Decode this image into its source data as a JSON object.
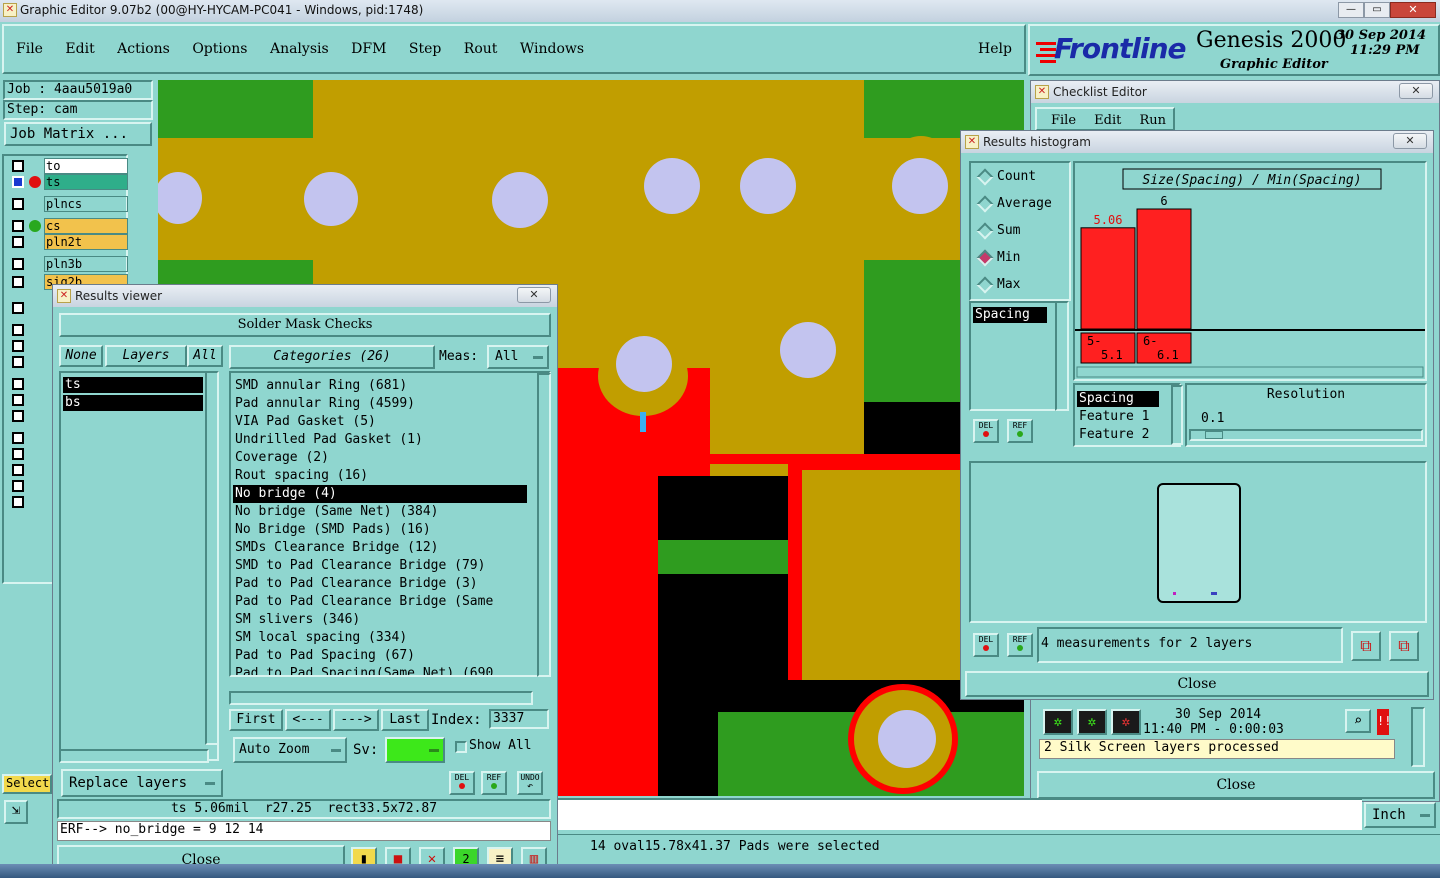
{
  "window": {
    "title": "Graphic Editor 9.07b2 (00@HY-HYCAM-PC041 - Windows, pid:1748)"
  },
  "menu": {
    "items": [
      "File",
      "Edit",
      "Actions",
      "Options",
      "Analysis",
      "DFM",
      "Step",
      "Rout",
      "Windows"
    ],
    "help": "Help"
  },
  "brand": {
    "logo": "Frontline",
    "product": "Genesis 2000",
    "subtitle": "Graphic Editor",
    "date": "30 Sep 2014",
    "time": "11:29 PM"
  },
  "job": {
    "job_label": "Job : 4aau5019a0",
    "step_label": "Step: cam",
    "matrix_button": "Job Matrix ..."
  },
  "layers": [
    {
      "name": "to"
    },
    {
      "name": "ts"
    },
    {
      "name": "plncs"
    },
    {
      "name": "cs"
    },
    {
      "name": "pln2t"
    },
    {
      "name": "pln3b"
    },
    {
      "name": "sig2b"
    }
  ],
  "select_label": "Select",
  "results_viewer": {
    "title": "Results viewer",
    "header": "Solder Mask Checks",
    "buttons": {
      "none": "None",
      "layers": "Layers",
      "all": "All",
      "categories": "Categories (26)",
      "meas_label": "Meas:",
      "meas_value": "All"
    },
    "layer_list": [
      "ts",
      "bs"
    ],
    "categories": [
      "SMD annular Ring (681)",
      "Pad annular Ring (4599)",
      "VIA Pad Gasket (5)",
      "Undrilled Pad Gasket (1)",
      "Coverage (2)",
      "Rout spacing (16)",
      "No bridge (4)",
      "No bridge (Same Net) (384)",
      "No Bridge (SMD Pads) (16)",
      "SMDs Clearance Bridge (12)",
      "SMD to Pad Clearance Bridge (79)",
      "Pad to Pad Clearance Bridge (3)",
      "Pad to Pad Clearance Bridge (Same",
      "SM slivers (346)",
      "SM local spacing (334)",
      "Pad to Pad Spacing (67)",
      "Pad to Pad Spacing(Same Net) (690"
    ],
    "selected_category_index": 6,
    "nav": {
      "first": "First",
      "prev": "<---",
      "next": "--->",
      "last": "Last",
      "index_label": "Index:",
      "index_value": "3337"
    },
    "auto_zoom": "Auto Zoom",
    "sv_label": "Sv:",
    "show_all": "Show All",
    "replace_layers": "Replace layers",
    "info_line": "ts 5.06mil  r27.25  rect33.5x72.87",
    "erf_line": "ERF--> no_bridge = 9 12 14",
    "close": "Close",
    "icon_labels": {
      "del": "DEL",
      "ref": "REF",
      "undo": "UNDO"
    }
  },
  "checklist_editor": {
    "title": "Checklist Editor",
    "menu": [
      "File",
      "Edit",
      "Run"
    ],
    "date": "30 Sep 2014",
    "time_range": "11:40 PM - 0:00:03",
    "status": "2 Silk Screen layers processed",
    "close": "Close",
    "unit": "Inch"
  },
  "histogram": {
    "title": "Results histogram",
    "radios": [
      "Count",
      "Average",
      "Sum",
      "Min",
      "Max"
    ],
    "selected_radio": "Min",
    "list_item": "Spacing",
    "legend_items": [
      "Spacing",
      "Feature 1",
      "Feature 2"
    ],
    "resolution_label": "Resolution",
    "resolution_value": "0.1",
    "measurements": "4 measurements for 2 layers",
    "close": "Close",
    "chart_data": {
      "type": "bar",
      "title": "Size(Spacing) / Min(Spacing)",
      "categories": [
        "5-\n5.1",
        "6-\n6.1"
      ],
      "category_lines": [
        [
          "5-",
          "5.1"
        ],
        [
          "6-",
          "6.1"
        ]
      ],
      "values": [
        5.06,
        6
      ],
      "value_labels": [
        "5.06",
        "6"
      ],
      "ylim": [
        0,
        6.6
      ],
      "bar_color": "#ff2020"
    }
  },
  "status_bar": {
    "message": "14 oval15.78x41.37 Pads were selected"
  },
  "colors": {
    "panel": "#8fd6cf",
    "copper": "#c19e00",
    "green": "#2f9c1f",
    "red": "#ff0000",
    "pad": "#c3c4ef"
  }
}
